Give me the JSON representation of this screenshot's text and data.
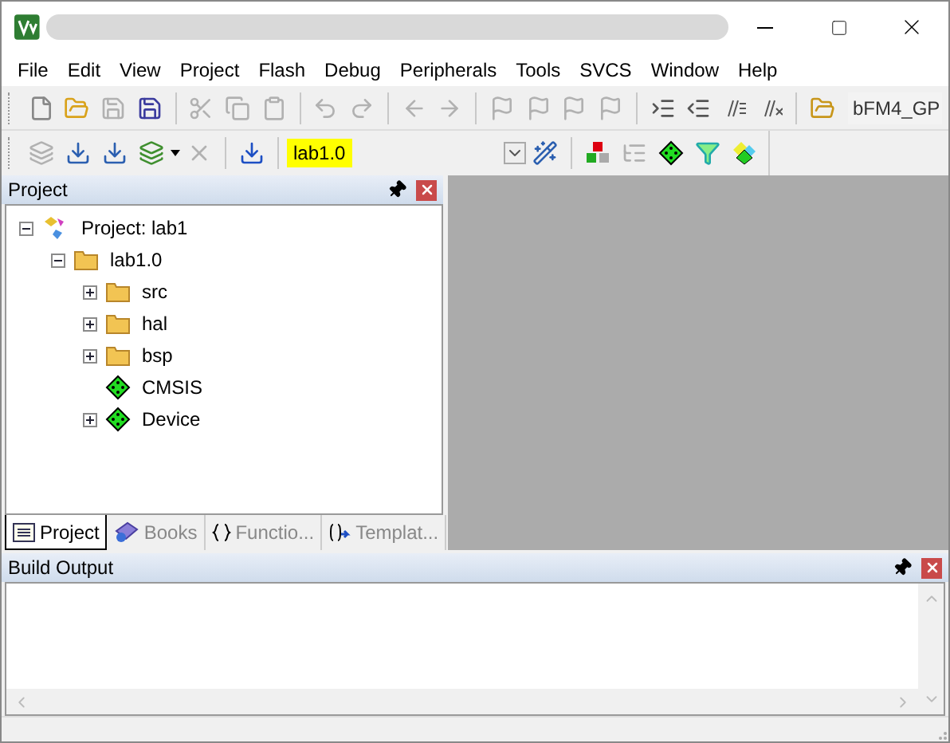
{
  "menu": [
    "File",
    "Edit",
    "View",
    "Project",
    "Flash",
    "Debug",
    "Peripherals",
    "Tools",
    "SVCS",
    "Window",
    "Help"
  ],
  "toolbar_file": [
    {
      "disabled": false
    },
    {
      "disabled": false
    },
    {
      "disabled": true
    },
    {
      "disabled": false
    },
    {
      "disabled": true
    },
    {
      "disabled": true
    },
    {
      "disabled": true
    },
    {
      "disabled": true
    },
    {
      "disabled": true
    },
    {
      "disabled": true
    },
    {
      "disabled": true
    },
    {
      "disabled": true
    },
    {
      "disabled": true
    },
    {
      "disabled": true
    },
    {
      "disabled": true
    },
    {
      "disabled": false
    },
    {
      "disabled": false
    },
    {
      "disabled": false
    },
    {
      "disabled": false
    },
    {
      "disabled": false
    }
  ],
  "find_field": {
    "value": "bFM4_GP"
  },
  "toolbar_build": [
    {
      "disabled": true
    },
    {
      "disabled": false
    },
    {
      "disabled": false
    },
    {
      "disabled": false
    },
    {
      "disabled": true
    },
    {
      "disabled": false
    }
  ],
  "target_select": {
    "value": "lab1.0"
  },
  "toolbar_target": [
    {
      "disabled": false
    },
    {
      "disabled": false
    },
    {
      "disabled": true
    },
    {
      "disabled": false
    },
    {
      "disabled": false
    },
    {
      "disabled": false
    }
  ],
  "project_panel": {
    "title": "Project",
    "tree": [
      {
        "label": "Project: lab1",
        "kind": "project",
        "expanded": true,
        "children": [
          {
            "label": "lab1.0",
            "kind": "target",
            "expanded": true,
            "children": [
              {
                "label": "src",
                "kind": "folder",
                "expanded": false
              },
              {
                "label": "hal",
                "kind": "folder",
                "expanded": false
              },
              {
                "label": "bsp",
                "kind": "folder",
                "expanded": false
              },
              {
                "label": "CMSIS",
                "kind": "component"
              },
              {
                "label": "Device",
                "kind": "component",
                "expanded": false
              }
            ]
          }
        ]
      }
    ],
    "tabs": [
      {
        "label": "Project",
        "kind": "project",
        "selected": true
      },
      {
        "label": "Books",
        "kind": "books",
        "selected": false
      },
      {
        "label": "Functio...",
        "kind": "functions",
        "selected": false
      },
      {
        "label": "Templat...",
        "kind": "templates",
        "selected": false
      }
    ]
  },
  "build_output": {
    "title": "Build Output"
  }
}
